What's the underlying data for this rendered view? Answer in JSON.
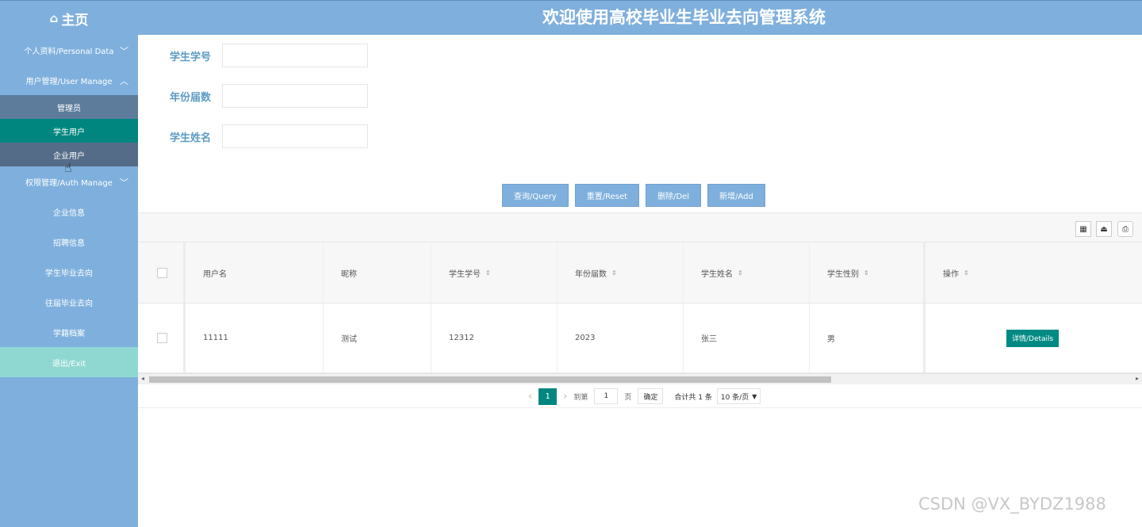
{
  "header": {
    "home_label": "主页",
    "title": "欢迎使用高校毕业生毕业去向管理系统"
  },
  "sidebar": {
    "personal": "个人资料/Personal Data",
    "user_manage": "用户管理/User Manage",
    "sub_items": [
      "管理员",
      "学生用户",
      "企业用户"
    ],
    "auth_manage": "权限管理/Auth Manage",
    "items": [
      "企业信息",
      "招聘信息",
      "学生毕业去向",
      "往届毕业去向",
      "学籍档案"
    ],
    "exit": "退出/Exit"
  },
  "search": {
    "fields": [
      "学生学号",
      "年份届数",
      "学生姓名"
    ]
  },
  "buttons": {
    "query": "查询/Query",
    "reset": "重置/Reset",
    "delete": "删除/Del",
    "add": "新增/Add"
  },
  "table": {
    "columns": [
      "用户名",
      "昵称",
      "学生学号",
      "年份届数",
      "学生姓名",
      "学生性别",
      "操作"
    ],
    "rows": [
      {
        "username": "11111",
        "nickname": "测试",
        "student_no": "12312",
        "year": "2023",
        "name": "张三",
        "gender": "男",
        "action": "详情/Details"
      }
    ]
  },
  "pagination": {
    "current_page": "1",
    "goto_label": "到第",
    "goto_value": "1",
    "page_unit": "页",
    "confirm": "确定",
    "total": "合计共 1 条",
    "page_size": "10 条/页"
  },
  "watermark": "CSDN @VX_BYDZ1988",
  "colors": {
    "header": "#7fb0dd",
    "active_item": "#00867f",
    "exit_item": "#8fd8d2",
    "details_button": "#008a83"
  }
}
